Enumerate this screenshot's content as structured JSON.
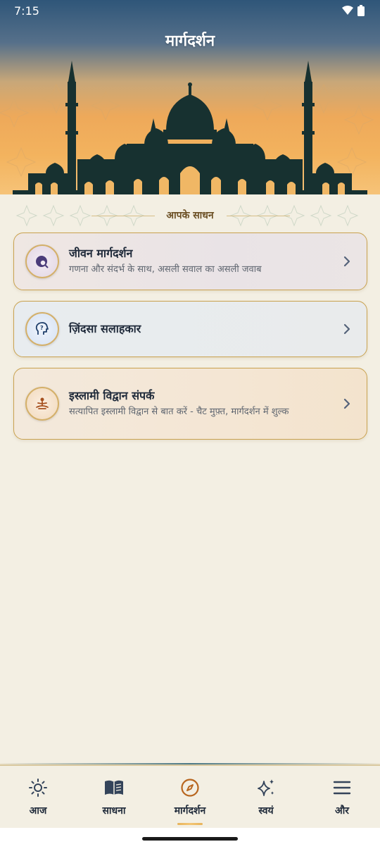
{
  "status_bar": {
    "time": "7:15"
  },
  "header": {
    "title": "मार्गदर्शन"
  },
  "section": {
    "label": "आपके साधन"
  },
  "cards": [
    {
      "title": "जीवन मार्गदर्शन",
      "subtitle": "गणना और संदर्भ के साथ, असली सवाल का असली जवाब",
      "icon": "globe-search-icon"
    },
    {
      "title": "ज़िंदसा सलाहकार",
      "subtitle": "",
      "icon": "head-question-icon"
    },
    {
      "title": "इस्लामी विद्वान संपर्क",
      "subtitle": "सत्यापित इस्लामी विद्वान से बात करें - चैट मुफ़्त, मार्गदर्शन में शुल्क",
      "icon": "meditation-person-icon"
    }
  ],
  "bottom_nav": {
    "items": [
      {
        "label": "आज",
        "icon": "sun-icon"
      },
      {
        "label": "साधना",
        "icon": "book-icon"
      },
      {
        "label": "मार्गदर्शन",
        "icon": "compass-icon",
        "active": true
      },
      {
        "label": "स्वयं",
        "icon": "sparkles-icon"
      },
      {
        "label": "और",
        "icon": "menu-icon"
      }
    ]
  },
  "colors": {
    "accent_gold": "#c9a24f",
    "active_compass": "#b8661f",
    "nav_text": "#1f2a3a"
  }
}
